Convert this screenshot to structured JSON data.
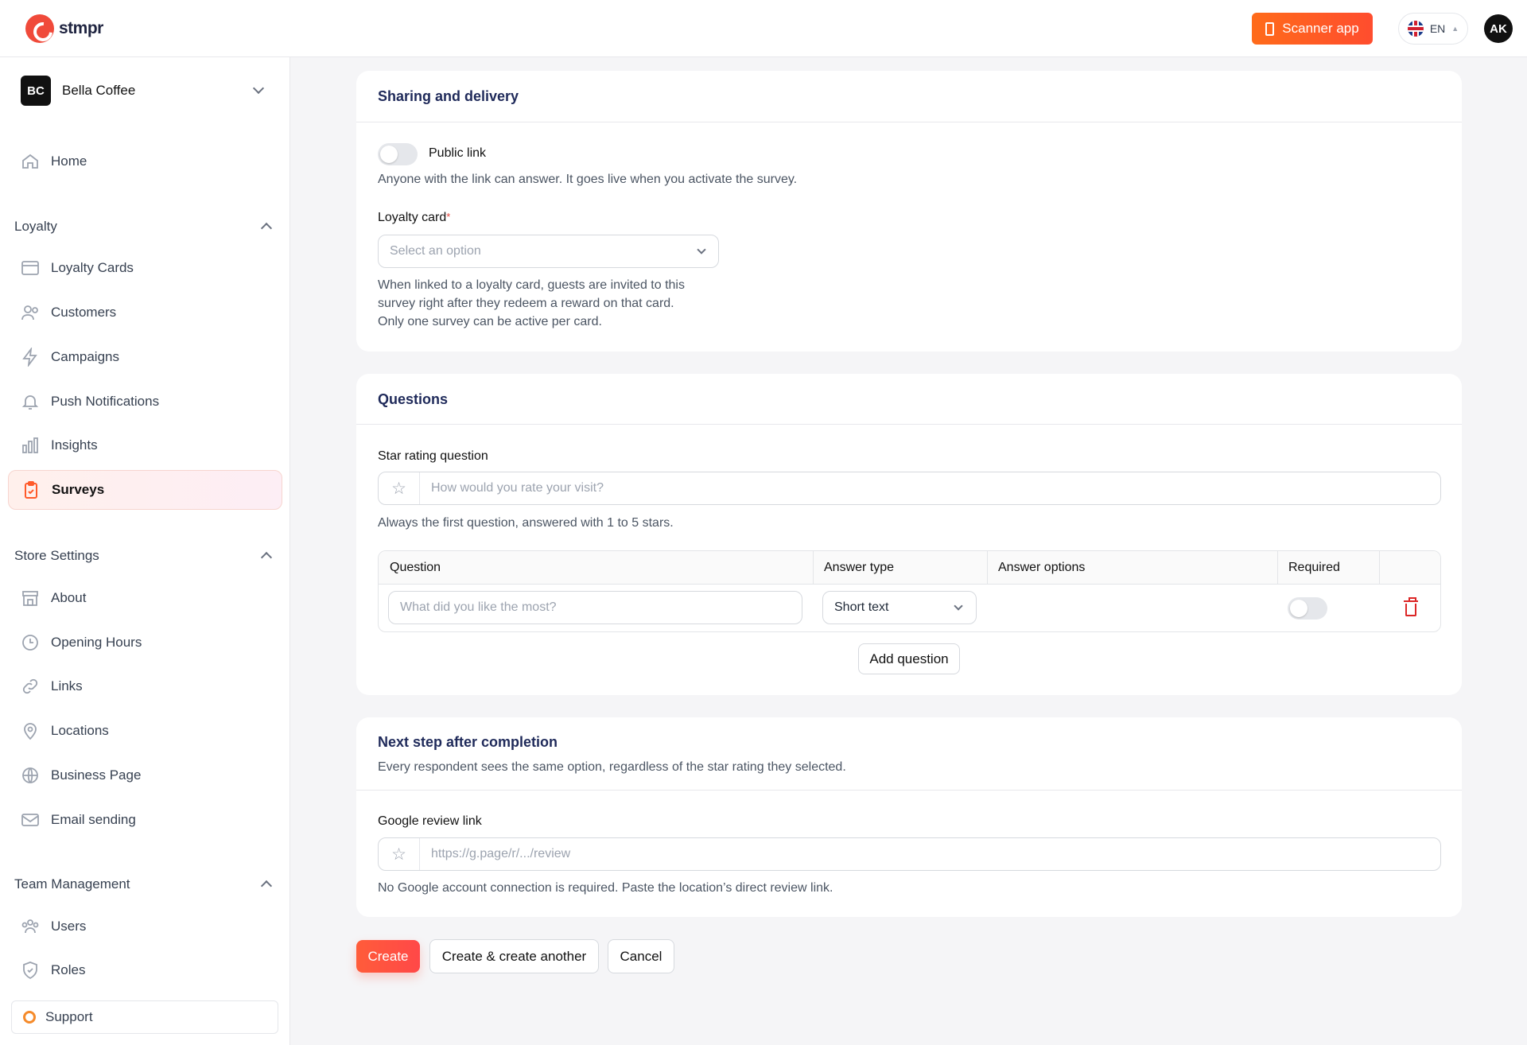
{
  "brand": {
    "name": "stmpr",
    "accent": "#ff5533"
  },
  "topbar": {
    "scanner_label": "Scanner app",
    "language": "EN",
    "user_initials": "AK"
  },
  "org": {
    "initials": "BC",
    "name": "Bella Coffee"
  },
  "sidebar": {
    "home": "Home",
    "sections": [
      {
        "title": "Loyalty",
        "items": [
          {
            "label": "Loyalty Cards",
            "icon": "card-icon"
          },
          {
            "label": "Customers",
            "icon": "users-icon"
          },
          {
            "label": "Campaigns",
            "icon": "bolt-icon"
          },
          {
            "label": "Push Notifications",
            "icon": "bell-icon"
          },
          {
            "label": "Insights",
            "icon": "chart-icon"
          },
          {
            "label": "Surveys",
            "icon": "clipboard-icon",
            "active": true
          }
        ]
      },
      {
        "title": "Store Settings",
        "items": [
          {
            "label": "About",
            "icon": "store-icon"
          },
          {
            "label": "Opening Hours",
            "icon": "clock-icon"
          },
          {
            "label": "Links",
            "icon": "link-icon"
          },
          {
            "label": "Locations",
            "icon": "pin-icon"
          },
          {
            "label": "Business Page",
            "icon": "globe-icon"
          },
          {
            "label": "Email sending",
            "icon": "mail-icon"
          }
        ]
      },
      {
        "title": "Team Management",
        "items": [
          {
            "label": "Users",
            "icon": "team-icon"
          },
          {
            "label": "Roles",
            "icon": "shield-icon"
          }
        ]
      }
    ],
    "support": "Support"
  },
  "sharing": {
    "title": "Sharing and delivery",
    "public_link_label": "Public link",
    "public_link_help": "Anyone with the link can answer. It goes live when you activate the survey.",
    "loyalty_card_label": "Loyalty card",
    "loyalty_card_placeholder": "Select an option",
    "loyalty_card_help_1": "When linked to a loyalty card, guests are invited to this",
    "loyalty_card_help_2": "survey right after they redeem a reward on that card.",
    "loyalty_card_help_3": "Only one survey can be active per card."
  },
  "questions": {
    "title": "Questions",
    "star_label": "Star rating question",
    "star_placeholder": "How would you rate your visit?",
    "star_help": "Always the first question, answered with 1 to 5 stars.",
    "columns": [
      "Question",
      "Answer type",
      "Answer options",
      "Required"
    ],
    "row": {
      "question_placeholder": "What did you like the most?",
      "answer_type": "Short text"
    },
    "add_label": "Add question"
  },
  "next_step": {
    "title": "Next step after completion",
    "subtitle": "Every respondent sees the same option, regardless of the star rating they selected.",
    "google_label": "Google review link",
    "google_placeholder": "https://g.page/r/.../review",
    "google_help": "No Google account connection is required. Paste the location’s direct review link."
  },
  "actions": {
    "create": "Create",
    "create_another": "Create & create another",
    "cancel": "Cancel"
  }
}
